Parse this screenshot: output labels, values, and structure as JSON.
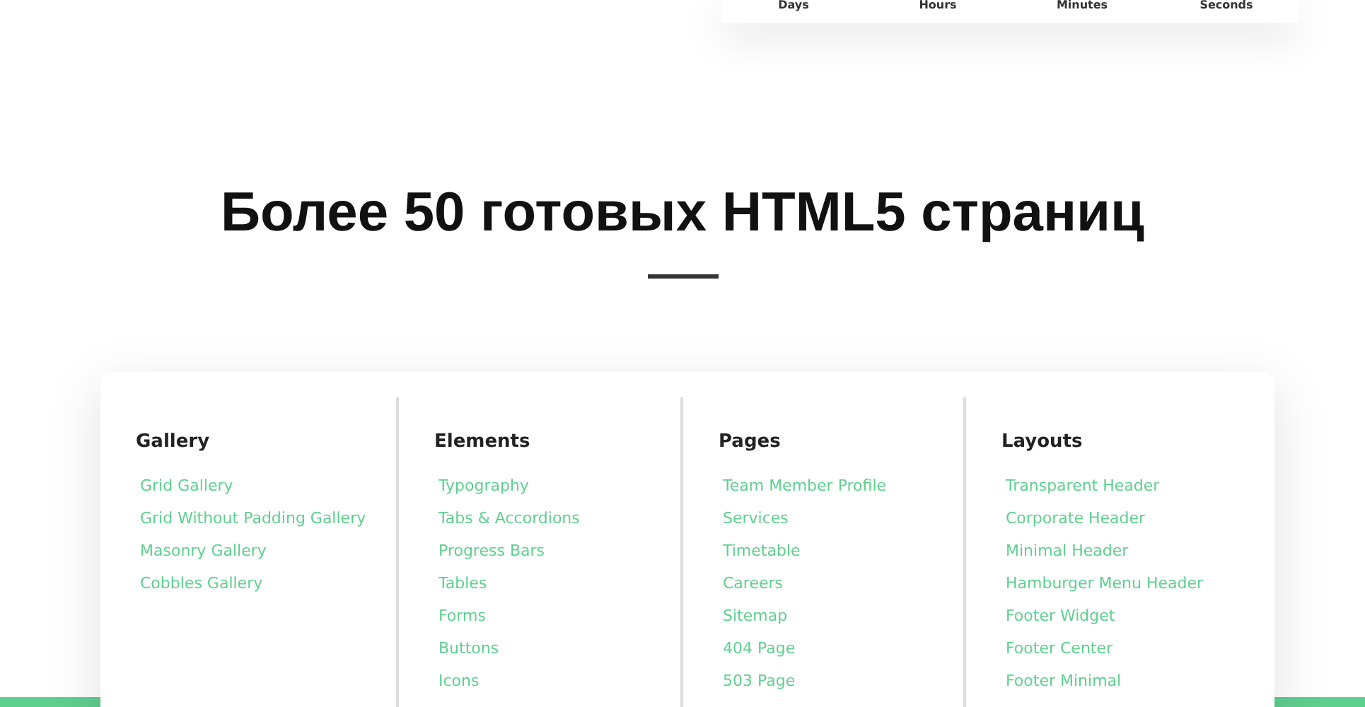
{
  "countdown": {
    "labels": [
      "Days",
      "Hours",
      "Minutes",
      "Seconds"
    ]
  },
  "section": {
    "title": "Более 50 готовых HTML5 страниц"
  },
  "columns": [
    {
      "heading": "Gallery",
      "links": [
        "Grid Gallery",
        "Grid Without Padding Gallery",
        "Masonry Gallery",
        "Cobbles Gallery"
      ]
    },
    {
      "heading": "Elements",
      "links": [
        "Typography",
        "Tabs & Accordions",
        "Progress Bars",
        "Tables",
        "Forms",
        "Buttons",
        "Icons"
      ]
    },
    {
      "heading": "Pages",
      "links": [
        "Team Member Profile",
        "Services",
        "Timetable",
        "Careers",
        "Sitemap",
        "404 Page",
        "503 Page"
      ]
    },
    {
      "heading": "Layouts",
      "links": [
        "Transparent Header",
        "Corporate Header",
        "Minimal Header",
        "Hamburger Menu Header",
        "Footer Widget",
        "Footer Center",
        "Footer Minimal"
      ]
    }
  ]
}
